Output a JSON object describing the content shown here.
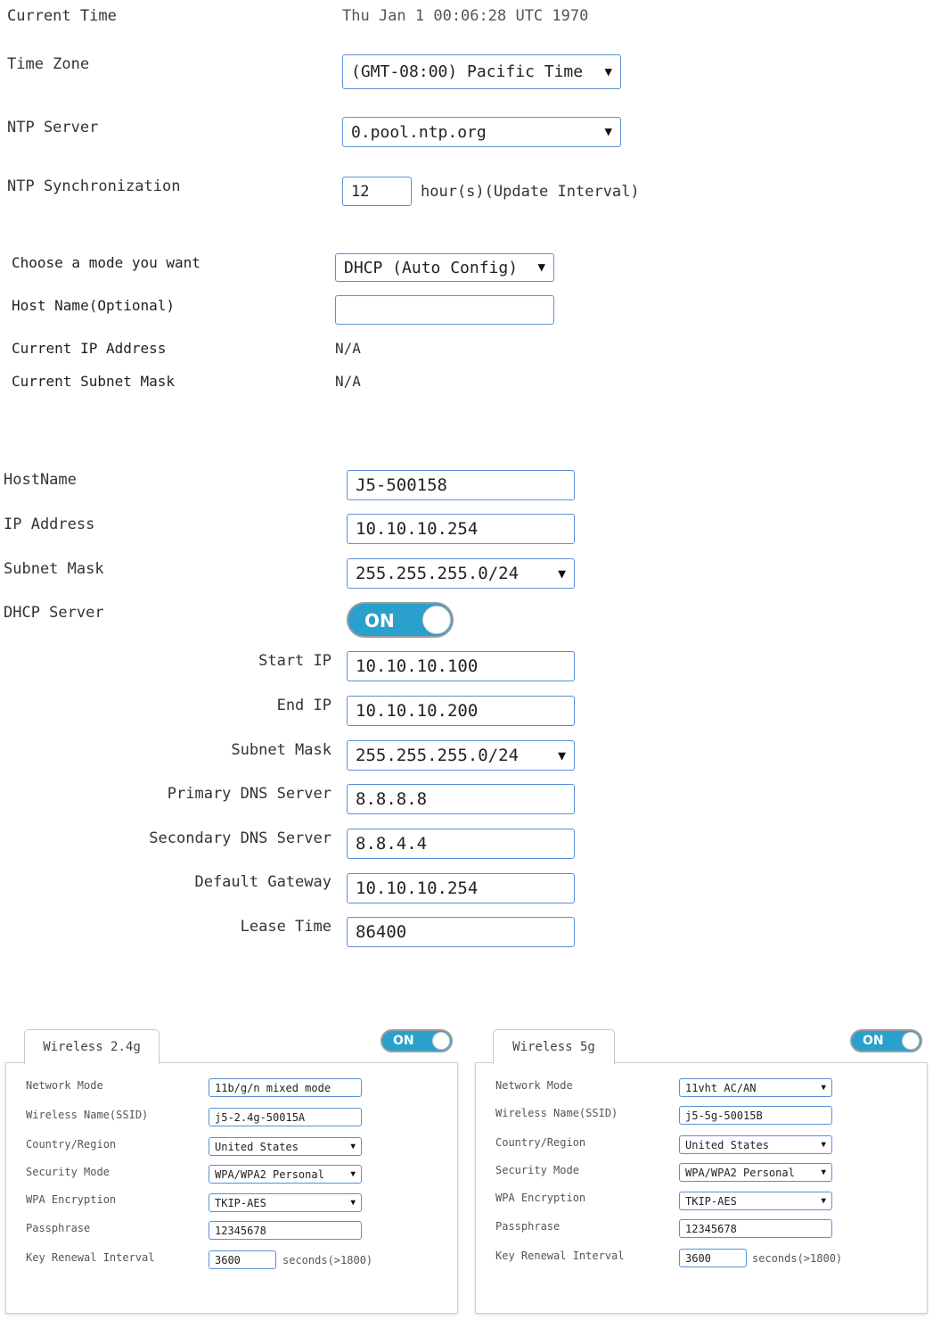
{
  "time": {
    "current_time_label": "Current Time",
    "current_time_value": "Thu Jan 1 00:06:28 UTC 1970",
    "time_zone_label": "Time Zone",
    "time_zone_value": "(GMT-08:00) Pacific Time",
    "ntp_server_label": "NTP Server",
    "ntp_server_value": "0.pool.ntp.org",
    "ntp_sync_label": "NTP Synchronization",
    "ntp_sync_value": "12",
    "ntp_sync_unit": "hour(s)(Update Interval)"
  },
  "wan": {
    "mode_label": "Choose a mode you want",
    "mode_value": "DHCP (Auto Config)",
    "host_name_label": "Host Name(Optional)",
    "host_name_value": "",
    "current_ip_label": "Current IP Address",
    "current_ip_value": "N/A",
    "current_mask_label": "Current Subnet Mask",
    "current_mask_value": "N/A"
  },
  "lan": {
    "hostname_label": "HostName",
    "hostname_value": "J5-500158",
    "ip_label": "IP Address",
    "ip_value": "10.10.10.254",
    "mask_label": "Subnet Mask",
    "mask_value": "255.255.255.0/24",
    "dhcp_label": "DHCP Server",
    "dhcp_toggle": "ON",
    "start_ip_label": "Start IP",
    "start_ip_value": "10.10.10.100",
    "end_ip_label": "End IP",
    "end_ip_value": "10.10.10.200",
    "dhcp_mask_label": "Subnet Mask",
    "dhcp_mask_value": "255.255.255.0/24",
    "dns1_label": "Primary DNS Server",
    "dns1_value": "8.8.8.8",
    "dns2_label": "Secondary DNS Server",
    "dns2_value": "8.8.4.4",
    "gateway_label": "Default Gateway",
    "gateway_value": "10.10.10.254",
    "lease_label": "Lease Time",
    "lease_value": "86400"
  },
  "wireless": [
    {
      "tab": "Wireless 2.4g",
      "toggle": "ON",
      "network_mode_label": "Network Mode",
      "network_mode_value": "11b/g/n mixed mode",
      "ssid_label": "Wireless Name(SSID)",
      "ssid_value": "j5-2.4g-50015A",
      "country_label": "Country/Region",
      "country_value": "United States",
      "security_label": "Security Mode",
      "security_value": "WPA/WPA2 Personal",
      "encryption_label": "WPA Encryption",
      "encryption_value": "TKIP-AES",
      "passphrase_label": "Passphrase",
      "passphrase_value": "12345678",
      "key_renewal_label": "Key Renewal Interval",
      "key_renewal_value": "3600",
      "key_renewal_unit": "seconds(>1800)"
    },
    {
      "tab": "Wireless 5g",
      "toggle": "ON",
      "network_mode_label": "Network Mode",
      "network_mode_value": "11vht AC/AN",
      "ssid_label": "Wireless Name(SSID)",
      "ssid_value": "j5-5g-50015B",
      "country_label": "Country/Region",
      "country_value": "United States",
      "security_label": "Security Mode",
      "security_value": "WPA/WPA2 Personal",
      "encryption_label": "WPA Encryption",
      "encryption_value": "TKIP-AES",
      "passphrase_label": "Passphrase",
      "passphrase_value": "12345678",
      "key_renewal_label": "Key Renewal Interval",
      "key_renewal_value": "3600",
      "key_renewal_unit": "seconds(>1800)"
    }
  ]
}
